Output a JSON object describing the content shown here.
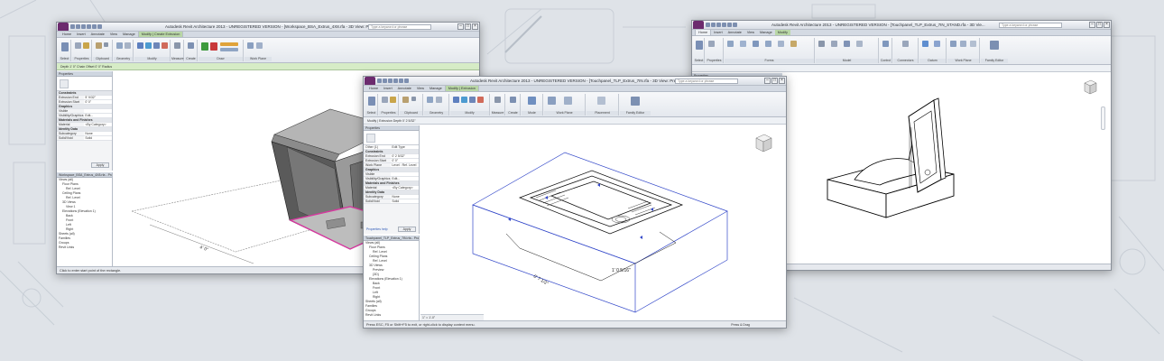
{
  "windows": [
    {
      "title": "Autodesk Revit Architecture 2013 - UNREGISTERED VERSION - [Workspace_BSA_Extrus_4X8.rfa - 3D View: Preview]",
      "search_placeholder": "Type a keyword or phrase",
      "tabs": [
        "Home",
        "Insert",
        "Annotate",
        "View",
        "Manage",
        "Modify | Create Extrusion"
      ],
      "ribbon_groups": [
        "Select",
        "Properties",
        "Clipboard",
        "Geometry",
        "Modify",
        "Measure",
        "Create",
        "Draw",
        "Work Plane"
      ],
      "options_bar": "Depth 1' 0\"    Chain    Offset 0' 0\"    Radius",
      "properties_title": "Properties",
      "properties_rows": [
        {
          "k": "Constraints",
          "v": "",
          "group": true
        },
        {
          "k": "Extrusion End",
          "v": "5' 9/32\""
        },
        {
          "k": "Extrusion Start",
          "v": "0' 0\""
        },
        {
          "k": "Graphics",
          "v": "",
          "group": true
        },
        {
          "k": "Visible",
          "v": ""
        },
        {
          "k": "Visibility/Graphics",
          "v": "Edit..."
        },
        {
          "k": "Materials and Finishes",
          "v": "",
          "group": true
        },
        {
          "k": "Material",
          "v": "<By Category>"
        },
        {
          "k": "Identity Data",
          "v": "",
          "group": true
        },
        {
          "k": "Subcategory",
          "v": "None"
        },
        {
          "k": "Solid/Void",
          "v": "Solid"
        }
      ],
      "apply_label": "Apply",
      "browser_title": "Workspace_BSA_Extrus_4X8.rfa - Project Browser",
      "browser_items": [
        "Views (all)",
        "Floor Plans",
        "Ref. Level",
        "Ceiling Plans",
        "Ref. Level",
        "3D Views",
        "View 1",
        "Elevations (Elevation 1)",
        "Back",
        "Front",
        "Left",
        "Right",
        "Sheets (all)",
        "Families",
        "Groups",
        "Revit Links"
      ],
      "dimension_label": "4' 0\"",
      "status": "Click to enter start point of the rectangle."
    },
    {
      "title": "Autodesk Revit Architecture 2013 - UNREGISTERED VERSION - [Touchpanel_TLP_Extrus_7IN.rfa - 3D View: Preview]",
      "search_placeholder": "Type a keyword or phrase",
      "tabs": [
        "Home",
        "Insert",
        "Annotate",
        "View",
        "Manage",
        "Modify | Extrusion"
      ],
      "ribbon_groups": [
        "Select",
        "Properties",
        "Clipboard",
        "Geometry",
        "Modify",
        "Measure",
        "Create",
        "Mode",
        "Work Plane",
        "Placement",
        "Family Editor"
      ],
      "ribbon_buttons": [
        "Edit Extrusion",
        "Edit Work Plane",
        "Pick New",
        "Load into Project"
      ],
      "options_bar": "Modify | Extrusion    Depth   0' 2 5/32\"",
      "properties_title": "Properties",
      "type_label": "Other (1)",
      "edit_type_label": "Edit Type",
      "properties_rows": [
        {
          "k": "Constraints",
          "v": "",
          "group": true
        },
        {
          "k": "Extrusion End",
          "v": "0' 2 5/32\""
        },
        {
          "k": "Extrusion Start",
          "v": "0' 0\""
        },
        {
          "k": "Work Plane",
          "v": "Level : Ref. Level"
        },
        {
          "k": "Graphics",
          "v": "",
          "group": true
        },
        {
          "k": "Visible",
          "v": ""
        },
        {
          "k": "Visibility/Graphics",
          "v": "Edit..."
        },
        {
          "k": "Materials and Finishes",
          "v": "",
          "group": true
        },
        {
          "k": "Material",
          "v": "<By Category>"
        },
        {
          "k": "Identity Data",
          "v": "",
          "group": true
        },
        {
          "k": "Subcategory",
          "v": "None"
        },
        {
          "k": "Solid/Void",
          "v": "Solid"
        }
      ],
      "properties_help": "Properties help",
      "apply_label": "Apply",
      "browser_title": "Touchpanel_TLP_Extrus_7IN.rfa - Project Browser",
      "browser_items": [
        "Views (all)",
        "Floor Plans",
        "Ref. Level",
        "Ceiling Plans",
        "Ref. Level",
        "3D Views",
        "Preview",
        "{3D}",
        "Elevations (Elevation 1)",
        "Back",
        "Front",
        "Left",
        "Right",
        "Sheets (all)",
        "Families",
        "Groups",
        "Revit Links"
      ],
      "dimension_width": "1' 0 5/16\"",
      "dimension_depth": "0' 7 1/2\"",
      "view_scale": "1\" = 1'-0\"",
      "status": "Press ESC, F5 or Shift+F5 to exit, or right-click to display context menu.",
      "press_drag": "Press & Drag"
    },
    {
      "title": "Autodesk Revit Architecture 2013 - UNREGISTERED VERSION - [Touchpanel_TLP_Extrus_7IN_STAND.rfa - 3D Vie...",
      "search_placeholder": "Type a keyword or phrase",
      "tabs": [
        "Home",
        "Insert",
        "Annotate",
        "View",
        "Manage",
        "Modify"
      ],
      "ribbon_groups": [
        "Select",
        "Properties",
        "Forms",
        "Model",
        "Control",
        "Connectors",
        "Datum",
        "Work Plane",
        "Family Editor"
      ],
      "ribbon_buttons": [
        "Extrusion",
        "Blend",
        "Revolve",
        "Sweep",
        "Swept Blend",
        "Void Forms",
        "Model Line",
        "Component",
        "Model Text",
        "Opening",
        "Model Group",
        "Control",
        "Connector",
        "Reference Line",
        "Reference Plane",
        "Set",
        "Show",
        "Viewer",
        "Load into Project"
      ],
      "properties_title": "Properties",
      "press_drag": "Press & Drag"
    }
  ],
  "colors": {
    "background": "#dfe3e8",
    "selection": "#d6389f",
    "context_tab": "#b9d7a6",
    "ribbon": "#eef1f5",
    "sketch_blue": "#3348c9"
  }
}
